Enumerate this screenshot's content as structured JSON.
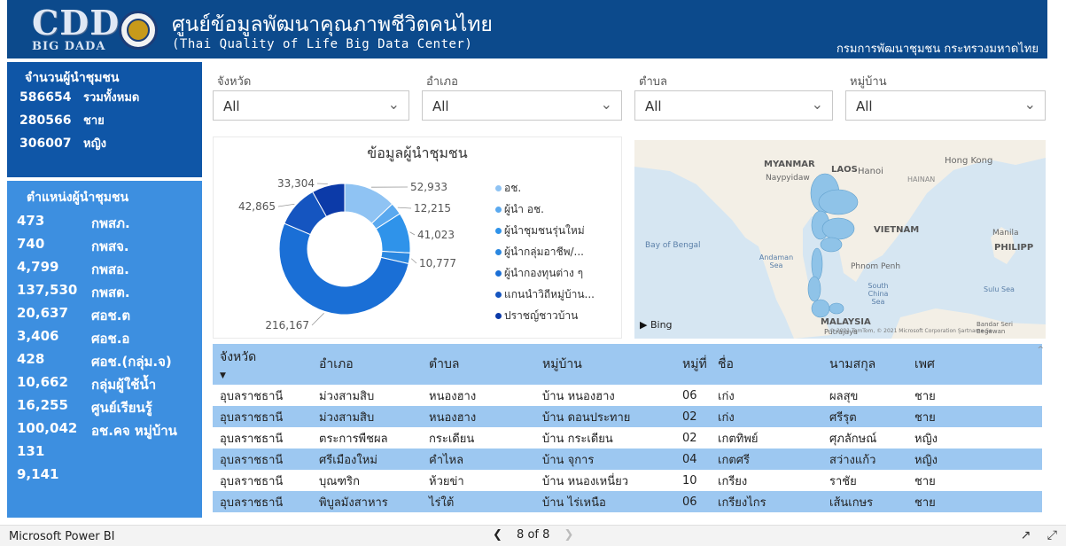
{
  "header": {
    "logo_text": "CDD",
    "logo_sub": "BIG DADA",
    "title": "ศูนย์ข้อมูลพัฒนาคุณภาพชีวิตคนไทย",
    "subtitle": "(Thai Quality of Life Big Data Center)",
    "right": "กรมการพัฒนาชุมชน กระทรวงมหาดไทย"
  },
  "leaders": {
    "title": "จำนวนผู้นำชุมชน",
    "rows": [
      {
        "value": "586654",
        "label": "รวมทั้งหมด"
      },
      {
        "value": "280566",
        "label": "ชาย"
      },
      {
        "value": "306007",
        "label": "หญิง"
      }
    ]
  },
  "positions": {
    "title": "ตำแหน่งผู้นำชุมชน",
    "values": [
      "473",
      "740",
      "4,799",
      "137,530",
      "20,637",
      "3,406",
      "428",
      "10,662",
      "16,255",
      "100,042",
      "131",
      "9,141"
    ],
    "labels": [
      "กพสภ.",
      "กพสจ.",
      "กพสอ.",
      "กพสต.",
      "ศอช.ต",
      "ศอช.อ",
      "ศอช.(กลุ่ม.จ)",
      "กลุ่มผู้ใช้น้ำ",
      "ศูนย์เรียนรู้",
      "อช.คจ หมู่บ้าน"
    ]
  },
  "slicers": [
    {
      "label": "จังหวัด",
      "value": "All"
    },
    {
      "label": "อำเภอ",
      "value": "All"
    },
    {
      "label": "ตำบล",
      "value": "All"
    },
    {
      "label": "หมู่บ้าน",
      "value": "All"
    }
  ],
  "chart_data": {
    "type": "pie",
    "title": "ข้อมูลผู้นำชุมชน",
    "categories": [
      "อช.",
      "ผู้นำ อช.",
      "ผู้นำชุมชนรุ่นใหม่",
      "ผู้นำกลุ่มอาชีพ/...",
      "ผู้นำกองทุนต่าง ๆ",
      "แกนนำวิถีหมู่บ้าน...",
      "ปราชญ์ชาวบ้าน"
    ],
    "values": [
      52933,
      12215,
      41023,
      10777,
      216167,
      42865,
      33304
    ],
    "labels": [
      "52,933",
      "12,215",
      "41,023",
      "10,777",
      "216,167",
      "42,865",
      "33,304"
    ],
    "colors": [
      "#8fc3f3",
      "#5aa9ef",
      "#2f93ea",
      "#2a87e0",
      "#1a6fd6",
      "#1555c0",
      "#0c3aa8"
    ],
    "donut": true,
    "legend": "right"
  },
  "map": {
    "labels": {
      "myanmar": "MYANMAR",
      "naypyidaw": "Naypyidaw",
      "laos": "LAOS",
      "hanoi": "Hanoi",
      "hainan": "HAINAN",
      "hongkong": "Hong Kong",
      "bay": "Bay of Bengal",
      "vietnam": "VIETNAM",
      "manila": "Manila",
      "philipp": "PHILIPP",
      "andaman": "Andaman Sea",
      "phnompenh": "Phnom Penh",
      "southchina": "South China Sea",
      "sulu": "Sulu Sea",
      "malaysia": "MALAYSIA",
      "putrajaya": "Putrajaya",
      "bandar": "Bandar Seri Begawan",
      "bing": "Bing",
      "copyright": "© 2021 TomTom, © 2021 Microsoft Corporation Şartname Se"
    }
  },
  "table": {
    "headers": [
      "จังหวัด",
      "อำเภอ",
      "ตำบล",
      "หมู่บ้าน",
      "หมู่ที่",
      "ชื่อ",
      "นามสกุล",
      "เพศ"
    ],
    "rows": [
      [
        "อุบลราชธานี",
        "ม่วงสามสิบ",
        "หนองฮาง",
        "บ้าน หนองฮาง",
        "06",
        "เก่ง",
        "ผลสุข",
        "ชาย"
      ],
      [
        "อุบลราชธานี",
        "ม่วงสามสิบ",
        "หนองฮาง",
        "บ้าน ดอนประทาย",
        "02",
        "เก่ง",
        "ศรีรุต",
        "ชาย"
      ],
      [
        "อุบลราชธานี",
        "ตระการพืชผล",
        "กระเดียน",
        "บ้าน กระเดียน",
        "02",
        "เกตทิพย์",
        "ศุภลักษณ์",
        "หญิง"
      ],
      [
        "อุบลราชธานี",
        "ศรีเมืองใหม่",
        "คำไหล",
        "บ้าน จุการ",
        "04",
        "เกตศรี",
        "สว่างแก้ว",
        "หญิง"
      ],
      [
        "อุบลราชธานี",
        "บุณฑริก",
        "ห้วยข่า",
        "บ้าน หนองเหนี่ยว",
        "10",
        "เกรียง",
        "ราชัย",
        "ชาย"
      ],
      [
        "อุบลราชธานี",
        "พิบูลมังสาหาร",
        "ไร่ใต้",
        "บ้าน ไร่เหนือ",
        "06",
        "เกรียงไกร",
        "เส้นเกษร",
        "ชาย"
      ]
    ]
  },
  "footer": {
    "brand": "Microsoft Power BI",
    "page_text": "8 of 8"
  }
}
